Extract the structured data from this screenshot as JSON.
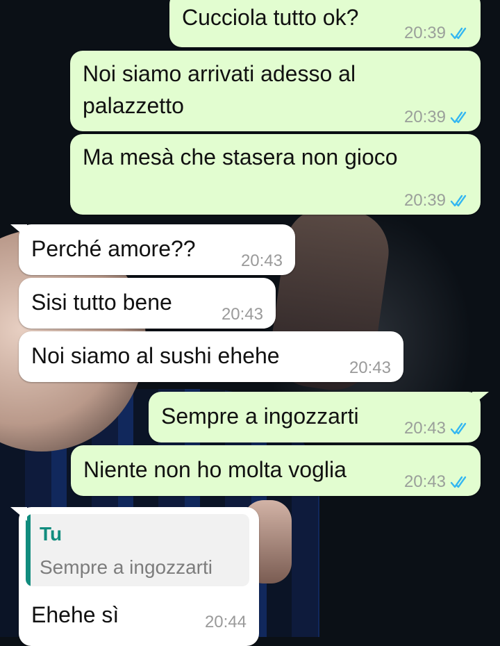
{
  "chat": {
    "messages": [
      {
        "direction": "out",
        "text": "Cucciola tutto ok?",
        "time": "20:39",
        "status": "read"
      },
      {
        "direction": "out",
        "text": "Noi siamo arrivati adesso al\npalazzetto",
        "time": "20:39",
        "status": "read"
      },
      {
        "direction": "out",
        "text": "Ma mesà che stasera non gioco",
        "time": "20:39",
        "status": "read"
      },
      {
        "direction": "in",
        "text": "Perché amore??",
        "time": "20:43"
      },
      {
        "direction": "in",
        "text": "Sisi tutto bene",
        "time": "20:43"
      },
      {
        "direction": "in",
        "text": "Noi siamo al sushi ehehe",
        "time": "20:43"
      },
      {
        "direction": "out",
        "text": "Sempre a ingozzarti",
        "time": "20:43",
        "status": "read"
      },
      {
        "direction": "out",
        "text": "Niente non ho molta voglia",
        "time": "20:43",
        "status": "read"
      },
      {
        "direction": "in",
        "text": "Ehehe sì",
        "time": "20:44",
        "reply_to": {
          "author": "Tu",
          "text": "Sempre a ingozzarti"
        }
      }
    ]
  },
  "colors": {
    "outgoing_bubble": "#e2fdd0",
    "incoming_bubble": "#ffffff",
    "read_ticks": "#34b7f1",
    "quote_accent": "#118c7e"
  },
  "icons": {
    "read_status": "double-check-icon"
  }
}
